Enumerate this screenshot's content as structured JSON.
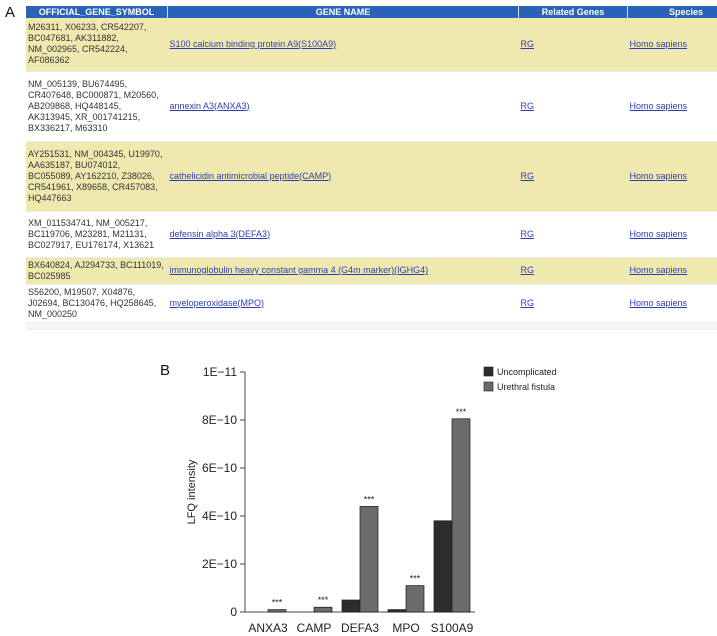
{
  "panel_labels": {
    "a": "A",
    "b": "B"
  },
  "table": {
    "headers": [
      "OFFICIAL_GENE_SYMBOL",
      "GENE NAME",
      "Related Genes",
      "Species"
    ],
    "rows": [
      {
        "symbols": "M26311, X06233, CR542207, BC047681, AK311882, NM_002965, CR542224, AF086362",
        "gene_name": "S100 calcium binding protein A9(S100A9)",
        "related": "RG",
        "species": "Homo sapiens"
      },
      {
        "symbols": "NM_005139, BU674495, CR407648, BC000871, M20560, AB209868, HQ448145, AK313945, XR_001741215, BX336217, M63310",
        "gene_name": "annexin A3(ANXA3)",
        "related": "RG",
        "species": "Homo sapiens"
      },
      {
        "symbols": "AY251531, NM_004345, U19970, AA635187, BU074012, BC055089, AY162210, Z38026, CR541961, X89658, CR457083, HQ447663",
        "gene_name": "cathelicidin antimicrobial peptide(CAMP)",
        "related": "RG",
        "species": "Homo sapiens"
      },
      {
        "symbols": "XM_011534741, NM_005217, BC119706, M23281, M21131, BC027917, EU176174, X13621",
        "gene_name": "defensin alpha 3(DEFA3)",
        "related": "RG",
        "species": "Homo sapiens"
      },
      {
        "symbols": "BX640824, AJ294733, BC111019, BC025985",
        "gene_name": "immunoglobulin heavy constant gamma 4 (G4m marker)(IGHG4)",
        "related": "RG",
        "species": "Homo sapiens"
      },
      {
        "symbols": "S56200, M19507, X04876, J02694, BC130476, HQ258645, NM_000250",
        "gene_name": "myeloperoxidase(MPO)",
        "related": "RG",
        "species": "Homo sapiens"
      }
    ]
  },
  "chart_data": {
    "type": "bar",
    "categories": [
      "ANXA3",
      "CAMP",
      "DEFA3",
      "MPO",
      "S100A9"
    ],
    "series": [
      {
        "name": "Uncomplicated",
        "color": "#2d2d2d",
        "values": [
          0.0,
          0.0,
          5e-11,
          1e-11,
          3.8e-10
        ]
      },
      {
        "name": "Urethral fistula",
        "color": "#6b6b6b",
        "values": [
          1e-11,
          2e-11,
          4.4e-10,
          1.1e-10,
          8.05e-10
        ]
      }
    ],
    "annotations": [
      "***",
      "***",
      "***",
      "***",
      "***"
    ],
    "xlabel": "",
    "ylabel": "LFQ intensity",
    "ylim": [
      0,
      1e-09
    ],
    "ytick_values": [
      0,
      2e-10,
      4e-10,
      6e-10,
      8e-10,
      1e-09
    ],
    "ytick_labels": [
      "0",
      "2E−10",
      "4E−10",
      "6E−10",
      "8E−10",
      "1E−11"
    ],
    "legend_position": "top-right",
    "grid": false
  }
}
